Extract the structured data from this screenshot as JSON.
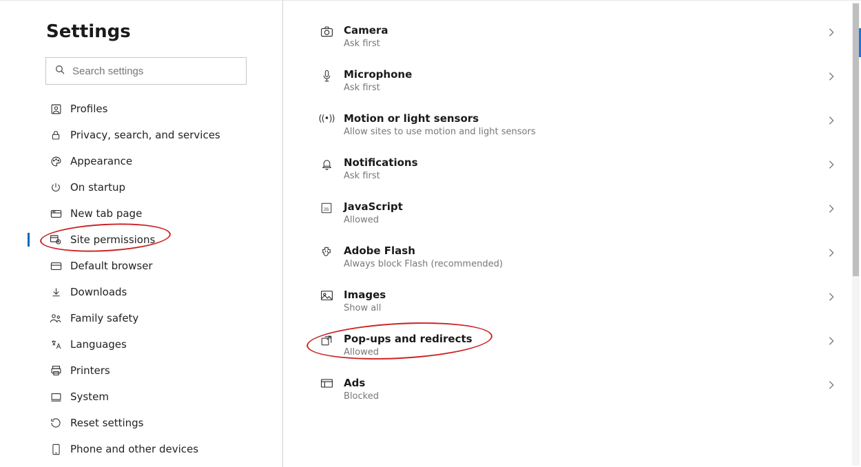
{
  "sidebar": {
    "title": "Settings",
    "search": {
      "placeholder": "Search settings",
      "value": ""
    },
    "items": [
      {
        "label": "Profiles"
      },
      {
        "label": "Privacy, search, and services"
      },
      {
        "label": "Appearance"
      },
      {
        "label": "On startup"
      },
      {
        "label": "New tab page"
      },
      {
        "label": "Site permissions"
      },
      {
        "label": "Default browser"
      },
      {
        "label": "Downloads"
      },
      {
        "label": "Family safety"
      },
      {
        "label": "Languages"
      },
      {
        "label": "Printers"
      },
      {
        "label": "System"
      },
      {
        "label": "Reset settings"
      },
      {
        "label": "Phone and other devices"
      }
    ],
    "active_index": 5
  },
  "permissions": [
    {
      "title": "Camera",
      "subtitle": "Ask first"
    },
    {
      "title": "Microphone",
      "subtitle": "Ask first"
    },
    {
      "title": "Motion or light sensors",
      "subtitle": "Allow sites to use motion and light sensors"
    },
    {
      "title": "Notifications",
      "subtitle": "Ask first"
    },
    {
      "title": "JavaScript",
      "subtitle": "Allowed"
    },
    {
      "title": "Adobe Flash",
      "subtitle": "Always block Flash (recommended)"
    },
    {
      "title": "Images",
      "subtitle": "Show all"
    },
    {
      "title": "Pop-ups and redirects",
      "subtitle": "Allowed"
    },
    {
      "title": "Ads",
      "subtitle": "Blocked"
    }
  ]
}
